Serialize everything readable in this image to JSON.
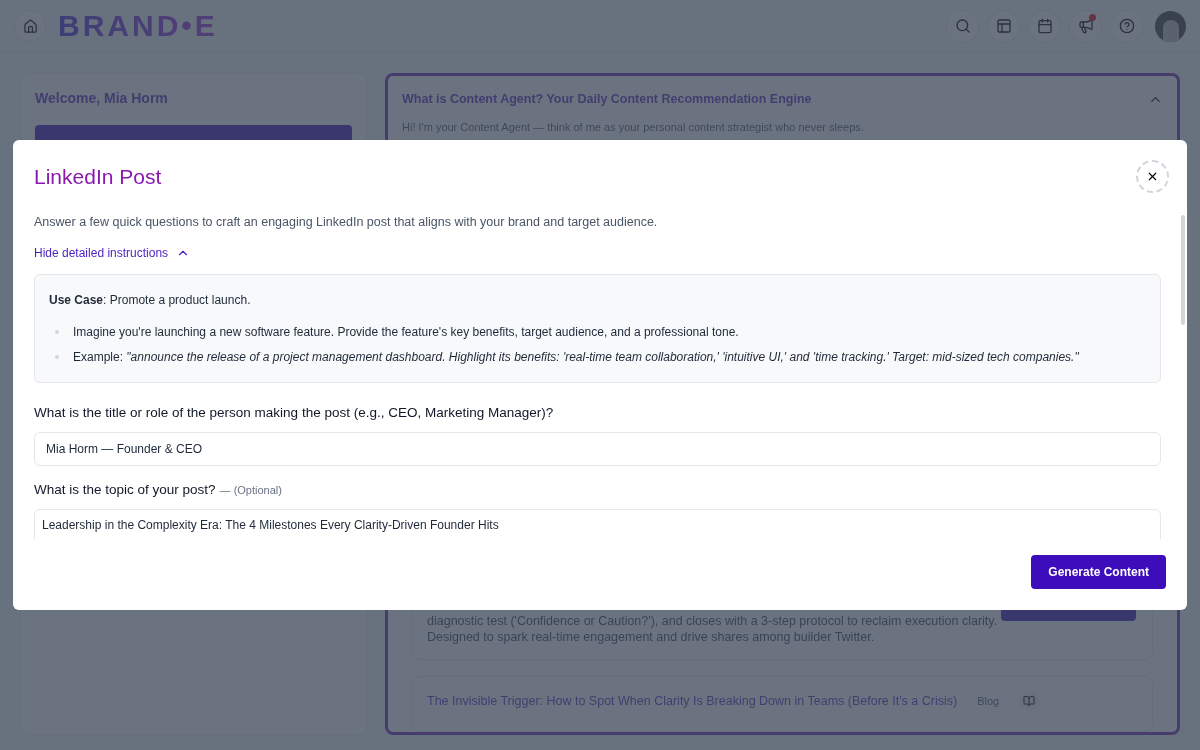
{
  "header": {
    "logo": "BRAND•E",
    "announcements_alert": true
  },
  "sidebar": {
    "welcome": "Welcome, Mia Horm"
  },
  "agent_panel": {
    "title": "What is Content Agent? Your Daily Content Recommendation Engine",
    "expanded": true,
    "intro": "Hi! I'm your Content Agent — think of me as your personal content strategist who never sleeps.",
    "recommendations": [
      {
        "kind": "detail",
        "lines": [
          "diagnostic test ('Confidence or Caution?'), and closes with a 3-step protocol to reclaim execution clarity.",
          "Designed to spark real-time engagement and drive shares among builder Twitter."
        ]
      },
      {
        "kind": "title",
        "title": "The Invisible Trigger: How to Spot When Clarity Is Breaking Down in Teams (Before It's a Crisis)",
        "type": "Blog"
      }
    ]
  },
  "modal": {
    "title": "LinkedIn Post",
    "description": "Answer a few quick questions to craft an engaging LinkedIn post that aligns with your brand and target audience.",
    "instructions_toggle": {
      "label": "Hide detailed instructions",
      "expanded": true
    },
    "instructions": {
      "use_case": "**Use Case**: Promote a product launch.",
      "bullets": [
        "Imagine you're launching a new software feature. Provide the feature's key benefits, target audience, and a professional tone.",
        "Example:  *\"announce the release of a project management dashboard. Highlight its benefits: 'real-time team collaboration,' 'intuitive UI,' and 'time tracking.' Target: mid-sized tech companies.\"*"
      ]
    },
    "questions": [
      {
        "kind": "input",
        "label": "What is the title or role of the person making the post (e.g., CEO, Marketing Manager)?",
        "value": "Mia Horm — Founder & CEO"
      },
      {
        "kind": "textarea",
        "label": "What is the topic of your post?",
        "hint": "— (Optional)",
        "value": "Leadership in the Complexity Era: The 4 Milestones Every Clarity-Driven Founder Hits"
      }
    ],
    "primary_button": "Generate Content"
  }
}
